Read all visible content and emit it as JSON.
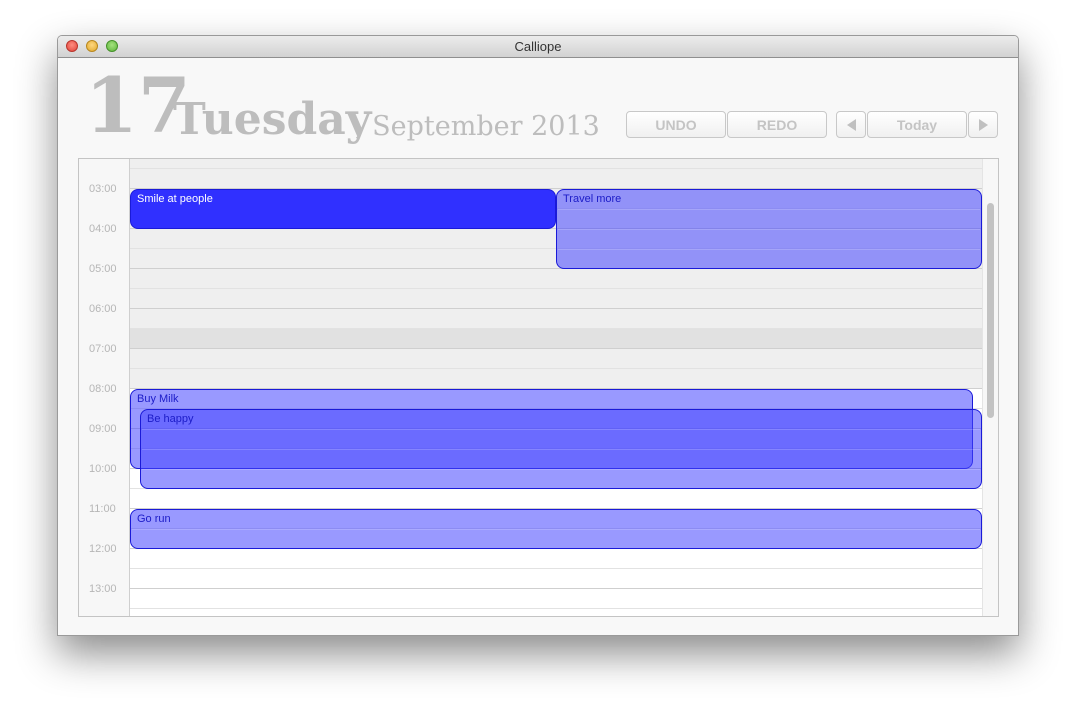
{
  "window": {
    "title": "Calliope"
  },
  "date": {
    "day": "17",
    "weekday": "Tuesday",
    "month_year": ", September 2013"
  },
  "toolbar": {
    "undo_label": "UNDO",
    "redo_label": "REDO",
    "today_label": "Today"
  },
  "icons": {
    "prev": "triangle-left-icon",
    "next": "triangle-right-icon"
  },
  "calendar": {
    "visible_hours": [
      "03:00",
      "04:00",
      "05:00",
      "06:00",
      "07:00",
      "08:00",
      "09:00",
      "10:00",
      "11:00",
      "12:00",
      "13:00"
    ],
    "events": [
      {
        "title": "Smile at people",
        "start": "03:00",
        "end": "04:00",
        "selected": true
      },
      {
        "title": "Travel more",
        "start": "03:00",
        "end": "05:00",
        "selected": false
      },
      {
        "title": "Buy Milk",
        "start": "08:00",
        "end": "10:00",
        "selected": false
      },
      {
        "title": "Be happy",
        "start": "08:30",
        "end": "10:30",
        "selected": false
      },
      {
        "title": "Go run",
        "start": "11:00",
        "end": "12:00",
        "selected": false
      }
    ]
  },
  "colors": {
    "event_fill": "#6a6aff",
    "event_selected": "#3030ff",
    "event_border": "#1a1ad8",
    "off_hours_band": "#efefef"
  }
}
